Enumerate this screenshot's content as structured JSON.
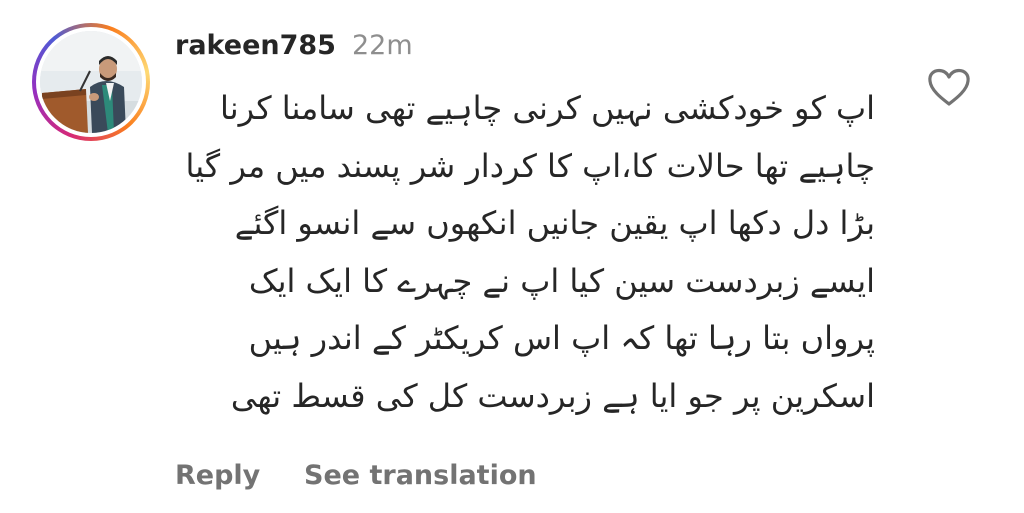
{
  "comment": {
    "username": "rakeen785",
    "timestamp": "22m",
    "lines": [
      "اپ کو خودکشی نہیں کرنی چاہیے تھی سامنا کرنا",
      "چاہیے تھا حالات کا،اپ کا کردار شر پسند میں مر گیا",
      "بڑا دل دکھا اپ یقین جانیں انکھوں سے انسو اگئے",
      "ایسے زبردست سین کیا اپ نے چہرے کا ایک ایک",
      "پرواں بتا رہا تھا کہ اپ اس کریکٹر کے اندر ہیں",
      "اسکرین پر جو ایا ہے زبردست کل کی قسط تھی"
    ],
    "like_icon": "heart-outline-icon",
    "actions": {
      "reply": "Reply",
      "see_translation": "See translation"
    }
  },
  "colors": {
    "primary_text": "#262626",
    "secondary_text": "#8e8e8e",
    "action_text": "#737373",
    "story_ring": [
      "#feda75",
      "#fa7e1e",
      "#d62976",
      "#962fbf",
      "#4f5bd5"
    ]
  }
}
